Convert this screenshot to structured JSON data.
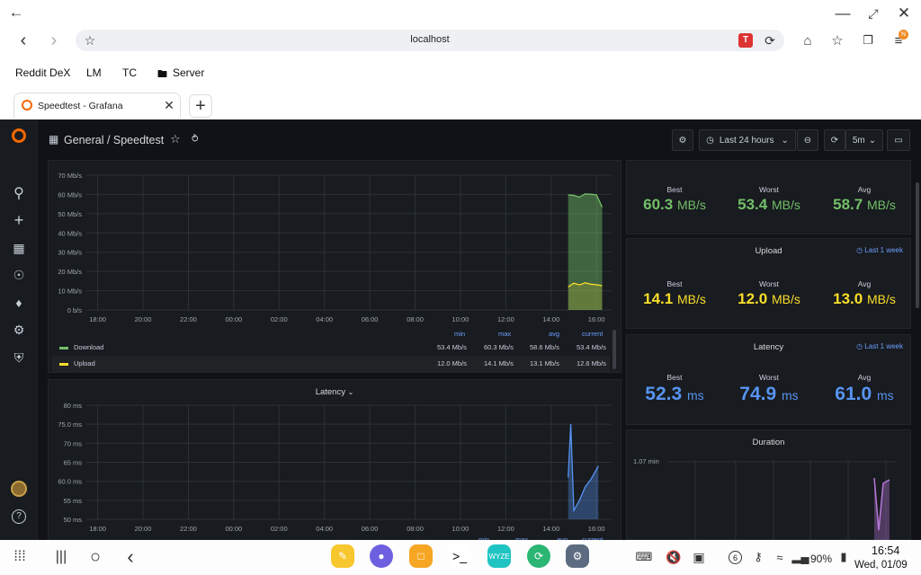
{
  "browser": {
    "url": "localhost",
    "bookmarks": [
      "Reddit DeX",
      "LM",
      "TC",
      "Server"
    ],
    "tab_title": "Speedtest - Grafana",
    "ext_badge": "T",
    "profile_badge": "N"
  },
  "grafana": {
    "breadcrumb": "General / Speedtest",
    "time_range": "Last 24 hours",
    "refresh": "5m",
    "speed_panel": {
      "y_ticks": [
        "70 Mb/s",
        "60 Mb/s",
        "50 Mb/s",
        "40 Mb/s",
        "30 Mb/s",
        "20 Mb/s",
        "10 Mb/s",
        "0 b/s"
      ],
      "x_ticks": [
        "18:00",
        "20:00",
        "22:00",
        "00:00",
        "02:00",
        "04:00",
        "06:00",
        "08:00",
        "10:00",
        "12:00",
        "14:00",
        "16:00"
      ],
      "legend_headers": [
        "min",
        "max",
        "avg",
        "current"
      ],
      "legend_rows": [
        {
          "name": "Download",
          "color": "#73bf69",
          "values": [
            "53.4 Mb/s",
            "60.3 Mb/s",
            "58.6 Mb/s",
            "53.4 Mb/s"
          ]
        },
        {
          "name": "Upload",
          "color": "#fade2a",
          "values": [
            "12.0 Mb/s",
            "14.1 Mb/s",
            "13.1 Mb/s",
            "12.6 Mb/s"
          ]
        }
      ]
    },
    "latency_panel": {
      "title": "Latency",
      "y_ticks": [
        "80 ms",
        "75.0 ms",
        "70 ms",
        "65 ms",
        "60.0 ms",
        "55 ms",
        "50 ms"
      ],
      "x_ticks": [
        "18:00",
        "20:00",
        "22:00",
        "00:00",
        "02:00",
        "04:00",
        "06:00",
        "08:00",
        "10:00",
        "12:00",
        "14:00",
        "16:00"
      ],
      "legend_headers": [
        "min",
        "max",
        "avg",
        "current"
      ]
    },
    "download_stats": {
      "color": "#73bf69",
      "best_label": "Best",
      "best_value": "60.3",
      "best_unit": "MB/s",
      "worst_label": "Worst",
      "worst_value": "53.4",
      "worst_unit": "MB/s",
      "avg_label": "Avg",
      "avg_value": "58.7",
      "avg_unit": "MB/s"
    },
    "upload_stats": {
      "title": "Upload",
      "link": "Last 1 week",
      "color": "#fade2a",
      "best_label": "Best",
      "best_value": "14.1",
      "best_unit": "MB/s",
      "worst_label": "Worst",
      "worst_value": "12.0",
      "worst_unit": "MB/s",
      "avg_label": "Avg",
      "avg_value": "13.0",
      "avg_unit": "MB/s"
    },
    "latency_stats": {
      "title": "Latency",
      "link": "Last 1 week",
      "color": "#5794f2",
      "best_label": "Best",
      "best_value": "52.3",
      "best_unit": "ms",
      "worst_label": "Worst",
      "worst_value": "74.9",
      "worst_unit": "ms",
      "avg_label": "Avg",
      "avg_value": "61.0",
      "avg_unit": "ms"
    },
    "duration_panel": {
      "title": "Duration",
      "y_tick": "1.07 min"
    }
  },
  "chart_data": [
    {
      "type": "area",
      "title": "",
      "x": [
        "14:45",
        "15:00",
        "15:15",
        "15:30",
        "15:45",
        "16:00",
        "16:15"
      ],
      "series": [
        {
          "name": "Download",
          "values": [
            59.8,
            59.5,
            58.6,
            60.3,
            60.1,
            59.8,
            53.4
          ]
        },
        {
          "name": "Upload",
          "values": [
            12.0,
            13.9,
            13.0,
            14.1,
            13.4,
            13.1,
            12.6
          ]
        }
      ],
      "ylim": [
        0,
        70
      ],
      "x_range": [
        "17:30",
        "16:40"
      ]
    },
    {
      "type": "line",
      "title": "Latency",
      "x": [
        "14:45",
        "14:52",
        "15:00",
        "15:15",
        "15:30",
        "15:45",
        "16:05"
      ],
      "series": [
        {
          "name": "",
          "values": [
            61,
            75,
            52.3,
            55,
            58.5,
            60.5,
            64
          ]
        }
      ],
      "ylim": [
        50,
        80
      ],
      "x_range": [
        "17:30",
        "16:40"
      ]
    }
  ],
  "system": {
    "clock": "16:54",
    "date": "Wed, 01/09",
    "battery": "90%",
    "notif_count": "6"
  }
}
